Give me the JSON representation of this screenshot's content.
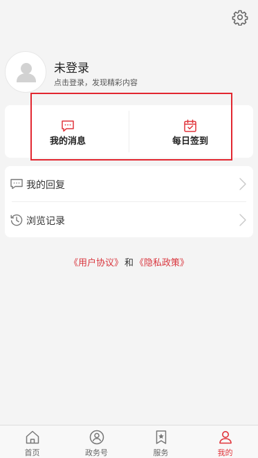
{
  "status_bar": {
    "time": "",
    "indicators": ""
  },
  "header": {
    "settings_icon": "gear-icon"
  },
  "profile": {
    "title": "未登录",
    "subtitle": "点击登录，发现精彩内容",
    "avatar_icon": "user-avatar-icon"
  },
  "quick_actions": [
    {
      "label": "我的消息",
      "icon": "message-icon"
    },
    {
      "label": "每日签到",
      "icon": "calendar-check-icon"
    }
  ],
  "menu": [
    {
      "label": "我的回复",
      "icon": "comment-icon"
    },
    {
      "label": "浏览记录",
      "icon": "history-icon"
    }
  ],
  "agreement": {
    "user_agreement": "《用户协议》",
    "connector": "和",
    "privacy_policy": "《隐私政策》"
  },
  "tabs": [
    {
      "label": "首页",
      "icon": "home-icon",
      "active": false
    },
    {
      "label": "政务号",
      "icon": "gov-account-icon",
      "active": false
    },
    {
      "label": "服务",
      "icon": "bookmark-star-icon",
      "active": false
    },
    {
      "label": "我的",
      "icon": "person-icon",
      "active": true
    }
  ],
  "colors": {
    "accent": "#e0343b",
    "highlight_box": "#e2262f",
    "background": "#f4f4f4",
    "card": "#ffffff"
  }
}
